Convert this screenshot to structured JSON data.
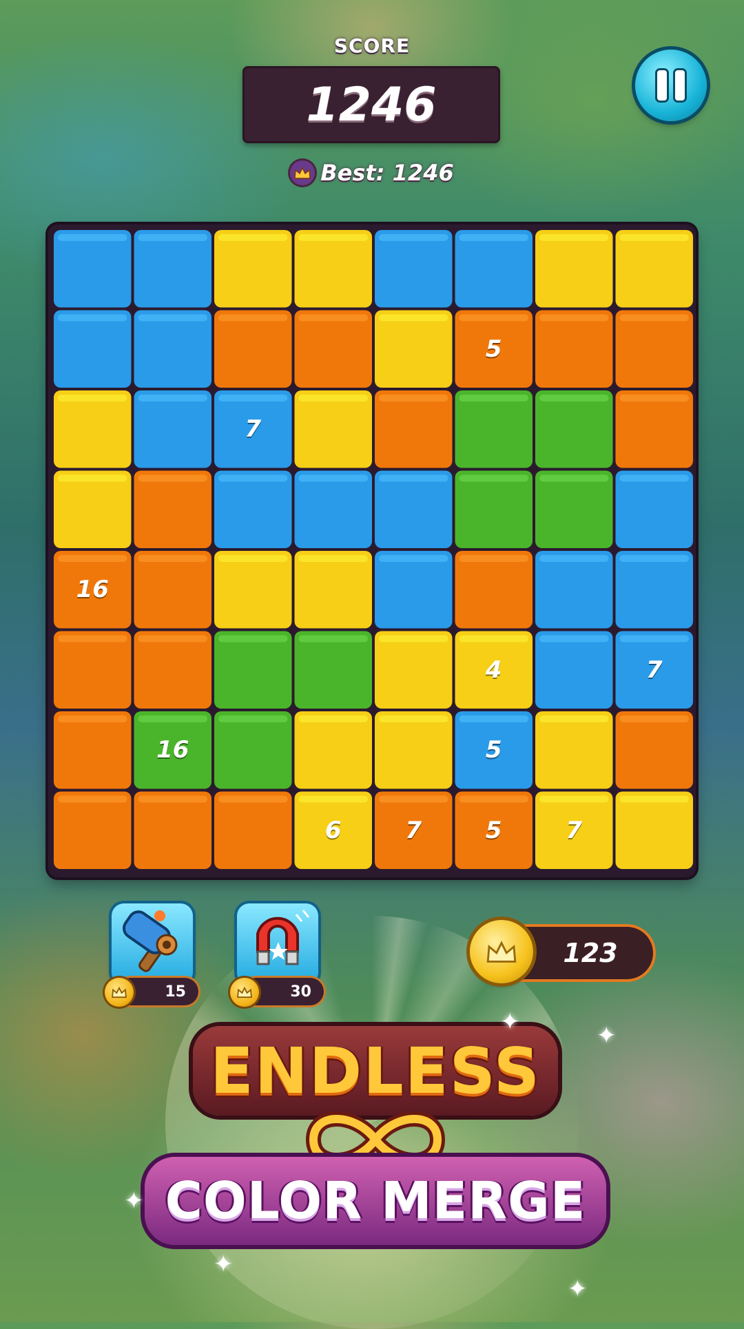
{
  "header": {
    "score_label": "SCORE",
    "score_value": "1246",
    "best_text": "Best: 1246"
  },
  "board": {
    "labels": [
      {
        "text": "5"
      },
      {
        "text": "7"
      },
      {
        "text": "16"
      },
      {
        "text": "4"
      },
      {
        "text": "7"
      },
      {
        "text": "16"
      },
      {
        "text": "5"
      },
      {
        "text": "6"
      },
      {
        "text": "7"
      },
      {
        "text": "5"
      },
      {
        "text": "7"
      }
    ]
  },
  "boosters": {
    "hammer": {
      "icon": "hammer-icon",
      "cost": "15"
    },
    "magnet": {
      "icon": "magnet-icon",
      "cost": "30"
    }
  },
  "coins": {
    "value": "123"
  },
  "logo": {
    "line1": "ENDLESS",
    "line2": "COLOR MERGE"
  },
  "colors": {
    "blue": "#2a9be8",
    "yellow": "#f6cf16",
    "orange": "#f0780a",
    "green": "#4ab52a",
    "board_bg": "#2b1a2e"
  }
}
